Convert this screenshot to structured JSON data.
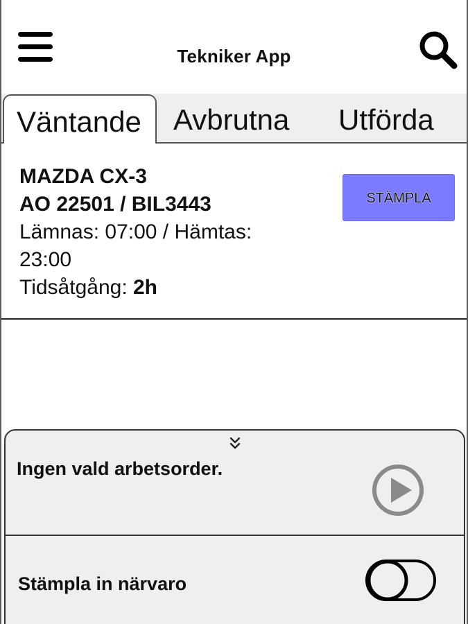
{
  "header": {
    "title": "Tekniker App",
    "menu_icon": "hamburger-menu-icon",
    "search_icon": "search-icon"
  },
  "tabs": [
    {
      "label": "Väntande",
      "active": true
    },
    {
      "label": "Avbrutna",
      "active": false
    },
    {
      "label": "Utförda",
      "active": false
    }
  ],
  "order": {
    "model": "MAZDA CX-3",
    "ids": "AO 22501 / BIL3443",
    "times_line1": "Lämnas: 07:00 / Hämtas:",
    "times_line2": "23:00",
    "duration_label": "Tidsåtgång: ",
    "duration_value": "2h",
    "button_label": "STÄMPLA"
  },
  "panel": {
    "collapse_icon": "double-chevron-down-icon",
    "status_text": "Ingen vald arbetsorder.",
    "play_icon": "play-circle-icon",
    "presence_label": "Stämpla in närvaro",
    "presence_toggle_on": false
  },
  "colors": {
    "button_bg": "#7b7bff",
    "tabbar_bg": "#efefef",
    "panel_bg": "#efefef",
    "play_icon": "#8a8a8a"
  }
}
